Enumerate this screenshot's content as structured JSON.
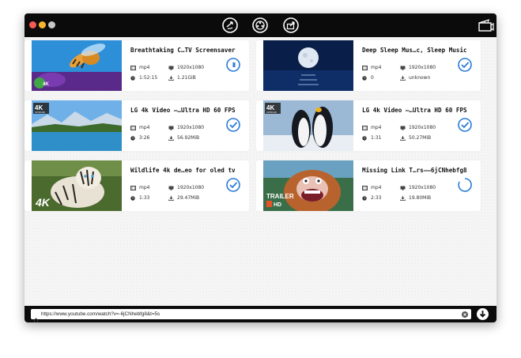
{
  "toolbar": {
    "buttons": [
      {
        "name": "refresh-circle-icon"
      },
      {
        "name": "film-reel-icon"
      },
      {
        "name": "share-icon"
      }
    ],
    "right_icon": "film-clapper-icon"
  },
  "videos": [
    {
      "title": "Breathtaking C…TV Screensaver",
      "format": "mp4",
      "resolution": "1920x1080",
      "duration": "1:52:15",
      "size": "1.21GiB",
      "status": "pending"
    },
    {
      "title": "Deep Sleep Mus…c, Sleep Music",
      "format": "mp4",
      "resolution": "1920x1080",
      "duration": "0",
      "size": "unknown",
      "status": "done"
    },
    {
      "title": "LG 4k Video –…Ultra HD 60 FPS",
      "format": "mp4",
      "resolution": "1920x1080",
      "duration": "3:26",
      "size": "56.92MiB",
      "status": "done"
    },
    {
      "title": "LG 4k Video –…Ultra HD 60 FPS",
      "format": "mp4",
      "resolution": "1920x1080",
      "duration": "1:31",
      "size": "50.27MiB",
      "status": "done"
    },
    {
      "title": "Wildlife 4k de…eo for oled tv",
      "format": "mp4",
      "resolution": "1920x1080",
      "duration": "1:33",
      "size": "29.47MiB",
      "status": "done"
    },
    {
      "title": "Missing Link T…rs––6jCNhebfg8",
      "format": "mp4",
      "resolution": "1920x1080",
      "duration": "2:33",
      "size": "19.80MiB",
      "status": "loading"
    }
  ],
  "thumb_labels": {
    "badge_4k": "4K",
    "ultra_hd": "ULTRA HD",
    "trailer": "TRAILER",
    "hd": "HD"
  },
  "url_bar": {
    "value": "https://www.youtube.com/watch?v=-6jCNhebfg8&t=5s"
  },
  "colors": {
    "accent": "#2a7bd8",
    "titlebar": "#0b0b0b"
  }
}
